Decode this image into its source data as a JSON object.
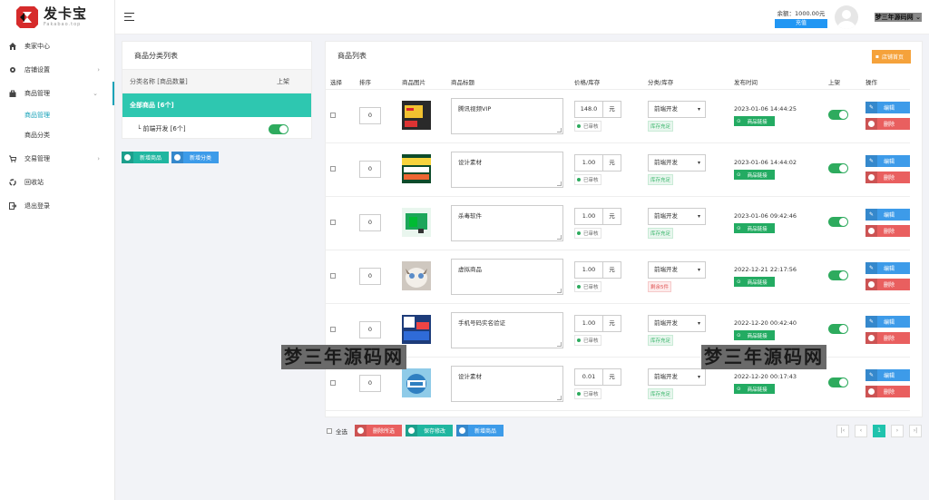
{
  "brand": {
    "title": "发卡宝",
    "subtitle": "Fakabao.top"
  },
  "sidebar": {
    "items": [
      {
        "label": "卖家中心",
        "icon": "home-icon"
      },
      {
        "label": "店铺设置",
        "icon": "gear-icon",
        "caret": "›"
      },
      {
        "label": "商品管理",
        "icon": "bag-icon",
        "caret": "⌄"
      },
      {
        "label": "交易管理",
        "icon": "cart-icon",
        "caret": "›"
      },
      {
        "label": "回收站",
        "icon": "recycle-icon"
      },
      {
        "label": "退出登录",
        "icon": "logout-icon"
      }
    ],
    "sub": [
      {
        "label": "商品管理"
      },
      {
        "label": "商品分类"
      }
    ]
  },
  "header": {
    "balance": "余额：1000.00元",
    "recharge": "充值",
    "username": "梦三年源码网"
  },
  "category_panel": {
    "title": "商品分类列表",
    "col_name": "分类名称 [商品数量]",
    "col_on": "上架",
    "all": "全部商品 [6个]",
    "row": "└ 前端开发 [6个]",
    "btn_add_goods": "新增商品",
    "btn_add_cat": "新增分类"
  },
  "goods_panel": {
    "title": "商品列表",
    "shop_btn": "店铺首页",
    "columns": [
      "选择",
      "排序",
      "商品图片",
      "商品标题",
      "价格/库存",
      "分类/库存",
      "发布时间",
      "上架",
      "操作"
    ],
    "select_all": "全选",
    "btn_delete": "删除所选",
    "btn_save": "保存修改",
    "btn_add": "新增商品",
    "rows": [
      {
        "sort": "0",
        "title": "腾讯视频VIP",
        "price": "148.0",
        "unit": "元",
        "audit": "已审核",
        "cat": "前端开发",
        "stock": "库存充足",
        "stock_ok": true,
        "date": "2023-01-06 14:44:25",
        "link": "商品链接",
        "edit": "编辑",
        "del": "删除"
      },
      {
        "sort": "0",
        "title": "设计素材",
        "price": "1.00",
        "unit": "元",
        "audit": "已审核",
        "cat": "前端开发",
        "stock": "库存充足",
        "stock_ok": true,
        "date": "2023-01-06 14:44:02",
        "link": "商品链接",
        "edit": "编辑",
        "del": "删除"
      },
      {
        "sort": "0",
        "title": "杀毒软件",
        "price": "1.00",
        "unit": "元",
        "audit": "已审核",
        "cat": "前端开发",
        "stock": "库存充足",
        "stock_ok": true,
        "date": "2023-01-06 09:42:46",
        "link": "商品链接",
        "edit": "编辑",
        "del": "删除"
      },
      {
        "sort": "0",
        "title": "虚拟商品",
        "price": "1.00",
        "unit": "元",
        "audit": "已审核",
        "cat": "前端开发",
        "stock": "剩余5件",
        "stock_ok": false,
        "date": "2022-12-21 22:17:56",
        "link": "商品链接",
        "edit": "编辑",
        "del": "删除"
      },
      {
        "sort": "0",
        "title": "手机号码实名验证",
        "price": "1.00",
        "unit": "元",
        "audit": "已审核",
        "cat": "前端开发",
        "stock": "库存充足",
        "stock_ok": true,
        "date": "2022-12-20 00:42:40",
        "link": "商品链接",
        "edit": "编辑",
        "del": "删除"
      },
      {
        "sort": "0",
        "title": "设计素材",
        "price": "0.01",
        "unit": "元",
        "audit": "已审核",
        "cat": "前端开发",
        "stock": "库存充足",
        "stock_ok": true,
        "date": "2022-12-20 00:17:43",
        "link": "商品链接",
        "edit": "编辑",
        "del": "删除"
      }
    ]
  },
  "pager": [
    "|‹",
    "‹",
    "1",
    "›",
    "›|"
  ],
  "watermark": "梦三年源码网"
}
